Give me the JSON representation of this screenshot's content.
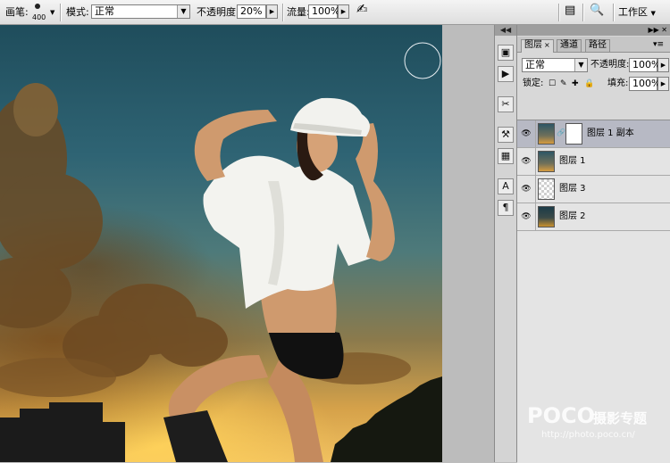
{
  "options_bar": {
    "brush_label": "画笔:",
    "brush_size": "400",
    "mode_label": "模式:",
    "mode_value": "正常",
    "opacity_label": "不透明度:",
    "opacity_value": "20%",
    "flow_label": "流量:",
    "flow_value": "100%",
    "workspace_label": "工作区"
  },
  "dock": {
    "collapse_glyph": "◀◀",
    "tools": [
      "brush-presets-icon",
      "actions-play-icon",
      "clone-source-icon",
      "tool-presets-icon",
      "layer-comps-icon",
      "character-icon",
      "paragraph-icon"
    ]
  },
  "layers_panel": {
    "header_glyph": "▶▶ ✕",
    "tabs": [
      {
        "label": "图层",
        "close": "×"
      },
      {
        "label": "通道"
      },
      {
        "label": "路径"
      }
    ],
    "menu_glyph": "▾≡",
    "blend_mode": "正常",
    "opacity_label": "不透明度:",
    "opacity_value": "100%",
    "lock_label": "锁定:",
    "fill_label": "填充:",
    "fill_value": "100%",
    "layers": [
      {
        "name": "图层 1 副本",
        "selected": true,
        "has_mask": true
      },
      {
        "name": "图层 1",
        "selected": false
      },
      {
        "name": "图层 3",
        "selected": false
      },
      {
        "name": "图层 2",
        "selected": false
      }
    ]
  },
  "watermark": {
    "brand": "POCO",
    "brand_cn": "摄影专题",
    "url": "http://photo.poco.cn/"
  }
}
